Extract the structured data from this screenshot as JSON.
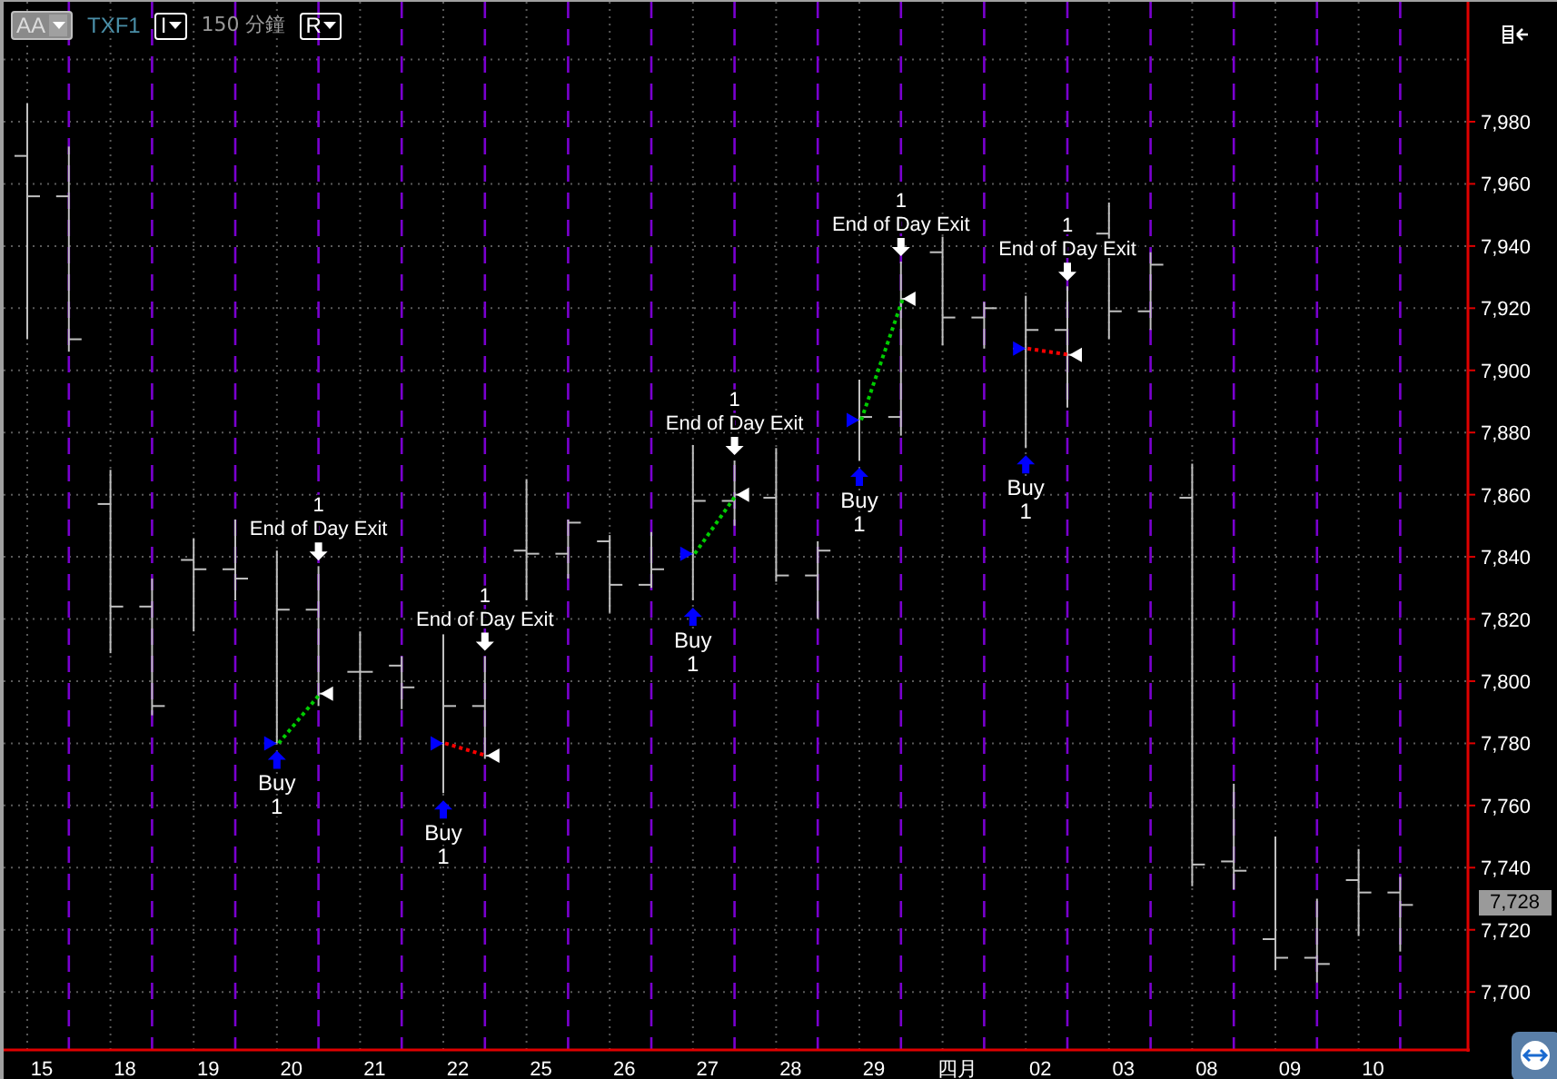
{
  "toolbar": {
    "style_button": "AA",
    "symbol": "TXF1",
    "chart_type_button": "I",
    "interval": "150 分鐘",
    "range_button": "R"
  },
  "trades": [
    {
      "color": "#00cc00",
      "entry_label": "Buy",
      "entry_qty": "1",
      "exit_label": "End of Day Exit",
      "exit_qty": "1"
    },
    {
      "color": "#ff0000",
      "entry_label": "Buy",
      "entry_qty": "1",
      "exit_label": "End of Day Exit",
      "exit_qty": "1"
    },
    {
      "color": "#00cc00",
      "entry_label": "Buy",
      "entry_qty": "1",
      "exit_label": "End of Day Exit",
      "exit_qty": "1"
    },
    {
      "color": "#00cc00",
      "entry_label": "Buy",
      "entry_qty": "1",
      "exit_label": "End of Day Exit",
      "exit_qty": "1"
    },
    {
      "color": "#ff0000",
      "entry_label": "Buy",
      "entry_qty": "1",
      "exit_label": "End of Day Exit",
      "exit_qty": "1"
    }
  ],
  "price_axis": [
    "7,980",
    "7,960",
    "7,940",
    "7,920",
    "7,900",
    "7,880",
    "7,860",
    "7,840",
    "7,820",
    "7,800",
    "7,780",
    "7,760",
    "7,740",
    "7,720",
    "7,700"
  ],
  "price_tag": "7,728",
  "date_axis": [
    "15",
    "18",
    "19",
    "20",
    "21",
    "22",
    "25",
    "26",
    "27",
    "28",
    "29",
    "四月",
    "02",
    "03",
    "08",
    "09",
    "10"
  ]
}
